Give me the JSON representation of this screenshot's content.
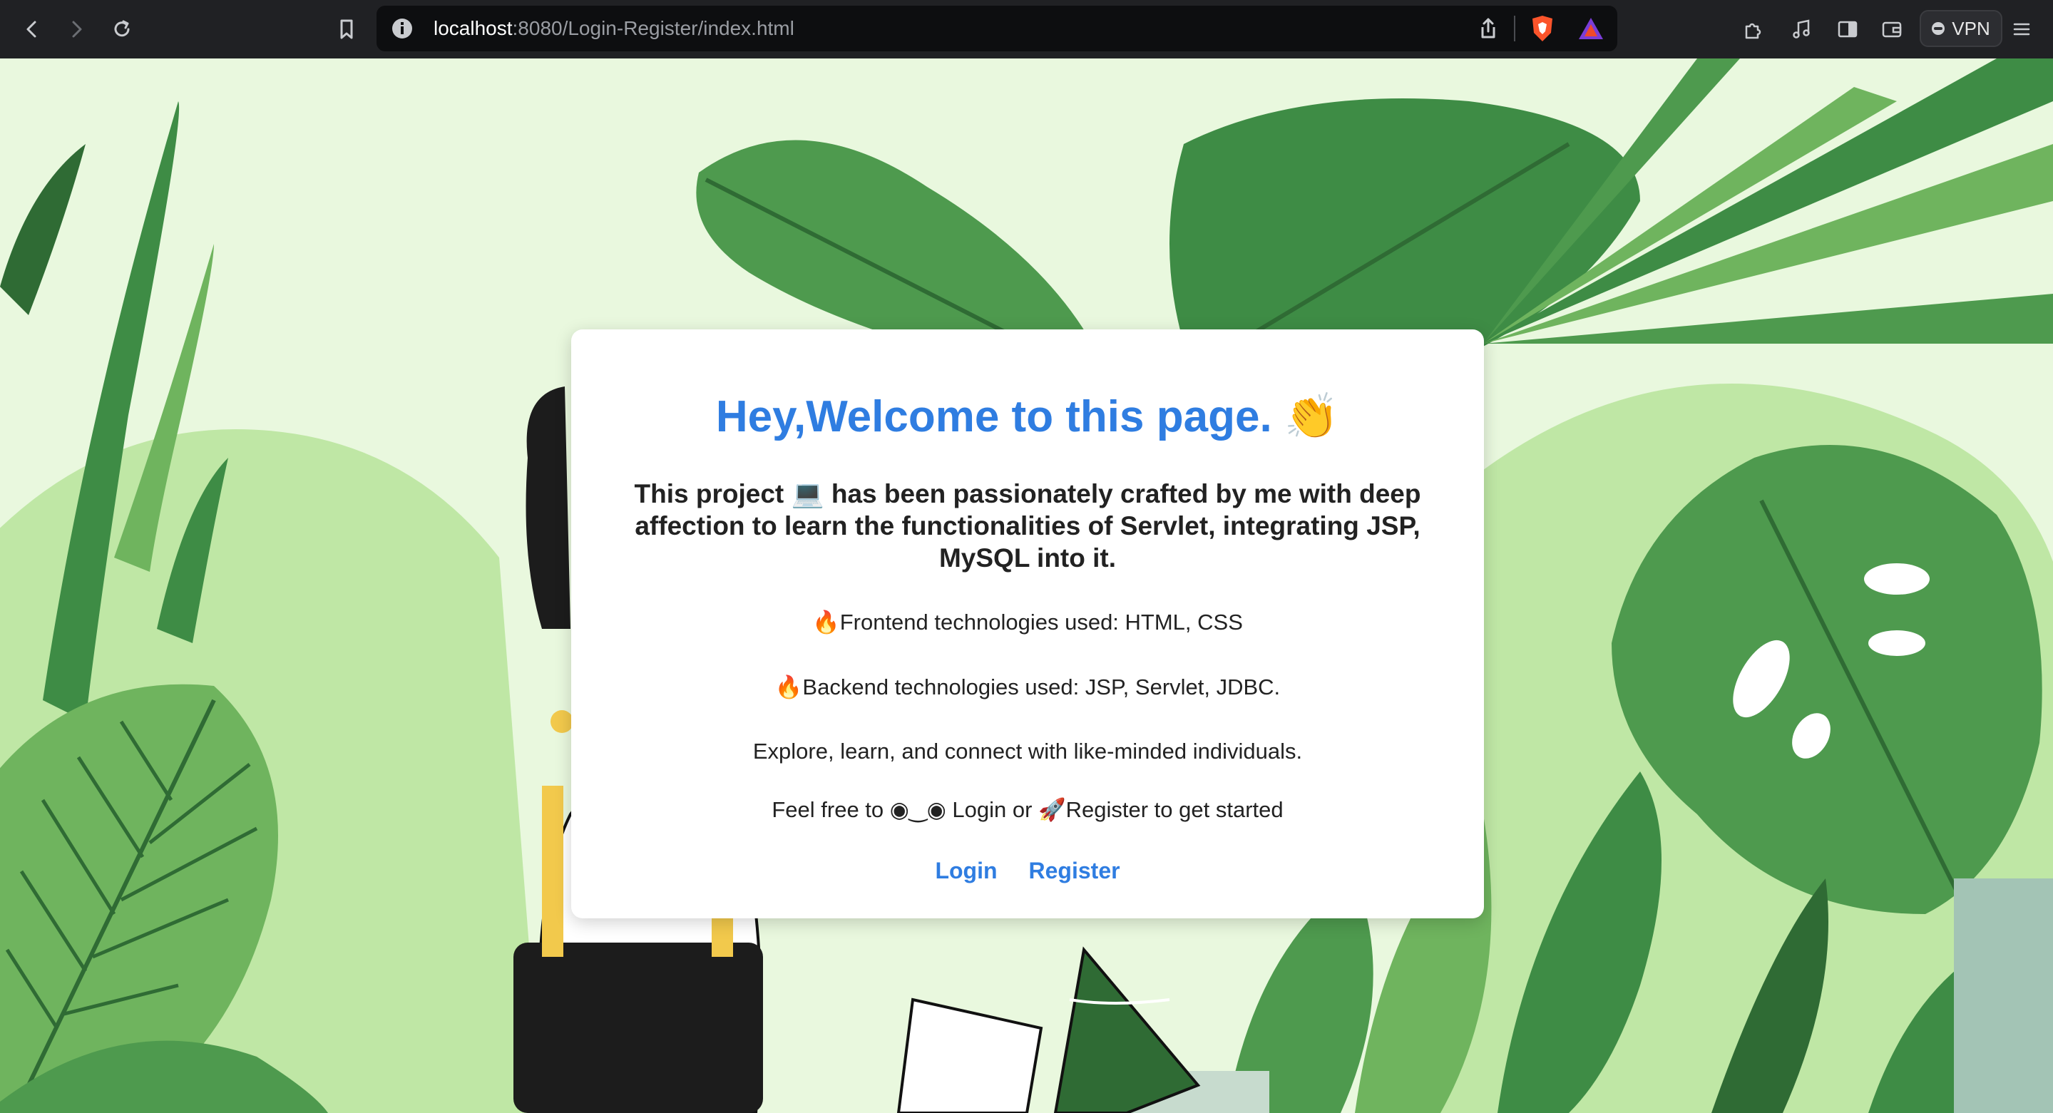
{
  "browser": {
    "url_host": "localhost",
    "url_rest": ":8080/Login-Register/index.html",
    "vpn_label": "VPN",
    "icons": [
      "back-icon",
      "forward-icon",
      "reload-icon",
      "bookmark-icon",
      "site-info-icon",
      "share-icon",
      "brave-shields-icon",
      "brave-rewards-icon",
      "extensions-icon",
      "media-icon",
      "sidebar-icon",
      "wallet-icon",
      "menu-icon"
    ]
  },
  "card": {
    "title": "Hey,Welcome to this page. 👏",
    "intro": "This project 💻 has been passionately crafted by me with deep affection to learn the functionalities of Servlet, integrating JSP, MySQL into it.",
    "frontend": "🔥Frontend technologies used: HTML, CSS",
    "backend": "🔥Backend technologies used: JSP, Servlet, JDBC.",
    "explore": "Explore, learn, and connect with like-minded individuals.",
    "cta": "Feel free to ◉‿◉ Login or 🚀Register to get started",
    "login_label": "Login",
    "register_label": "Register"
  },
  "colors": {
    "accent": "#2f7de1",
    "background": "#e9f8de",
    "leaf_dark": "#2f6b34",
    "leaf_mid": "#4e9a4e",
    "leaf_light": "#6fb45e"
  }
}
